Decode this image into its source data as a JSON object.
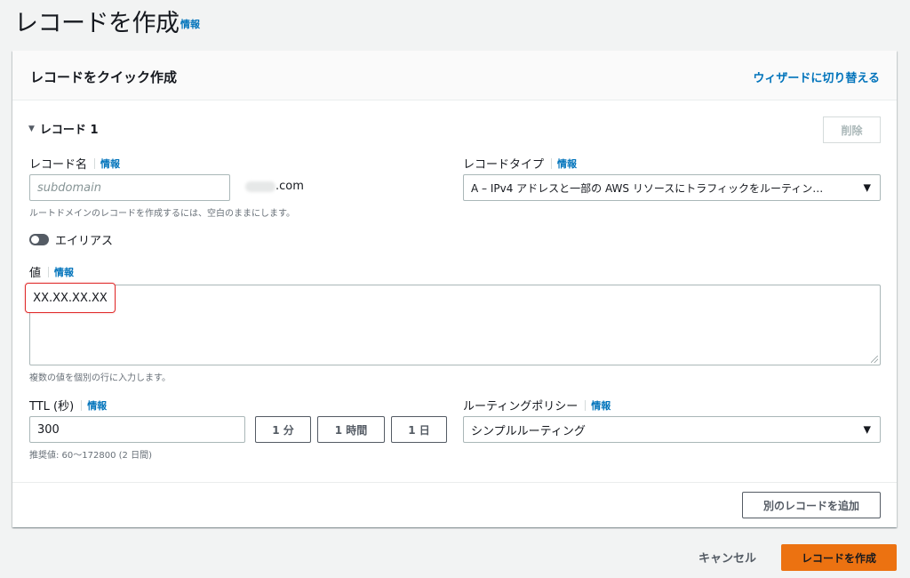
{
  "page": {
    "title": "レコードを作成",
    "info": "情報"
  },
  "panel": {
    "title": "レコードをクイック作成",
    "wizard_link": "ウィザードに切り替える"
  },
  "record": {
    "section_label": "レコード 1",
    "delete_label": "削除",
    "name": {
      "label": "レコード名",
      "info": "情報",
      "placeholder": "subdomain",
      "domain_suffix": ".com",
      "hint": "ルートドメインのレコードを作成するには、空白のままにします。"
    },
    "type": {
      "label": "レコードタイプ",
      "info": "情報",
      "selected": "A – IPv4 アドレスと一部の AWS リソースにトラフィックをルーティン…"
    },
    "alias": {
      "label": "エイリアス",
      "enabled": false
    },
    "value": {
      "label": "値",
      "info": "情報",
      "content": "XX.XX.XX.XX",
      "hint": "複数の値を個別の行に入力します。"
    },
    "ttl": {
      "label": "TTL (秒)",
      "info": "情報",
      "value": "300",
      "presets": [
        "1 分",
        "1 時間",
        "1 日"
      ],
      "hint": "推奨値: 60〜172800 (2 日間)"
    },
    "routing": {
      "label": "ルーティングポリシー",
      "info": "情報",
      "selected": "シンプルルーティング"
    }
  },
  "add_record_label": "別のレコードを追加",
  "footer": {
    "cancel_label": "キャンセル",
    "create_label": "レコードを作成"
  },
  "colors": {
    "link": "#0073bb",
    "primary_button": "#ec7211",
    "highlight_border": "#e02b2b",
    "background": "#f2f3f3"
  }
}
